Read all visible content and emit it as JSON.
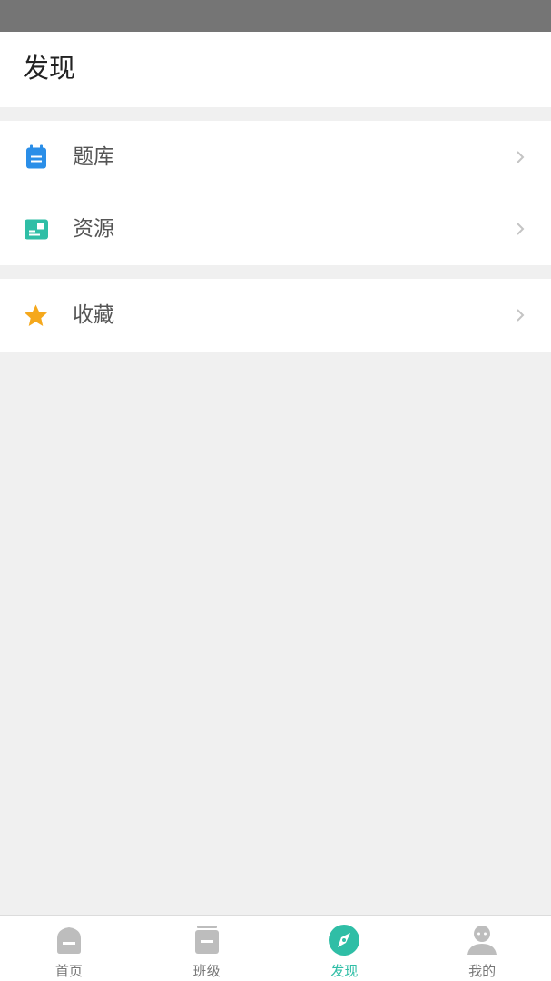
{
  "header": {
    "title": "发现"
  },
  "menu": {
    "groups": [
      {
        "items": [
          {
            "label": "题库",
            "icon": "question-bank-icon",
            "color": "#2a8ee8"
          },
          {
            "label": "资源",
            "icon": "resource-icon",
            "color": "#2fbea6"
          }
        ]
      },
      {
        "items": [
          {
            "label": "收藏",
            "icon": "star-icon",
            "color": "#f5a81c"
          }
        ]
      }
    ]
  },
  "tabbar": {
    "tabs": [
      {
        "label": "首页",
        "icon": "home-icon",
        "active": false
      },
      {
        "label": "班级",
        "icon": "class-icon",
        "active": false
      },
      {
        "label": "发现",
        "icon": "compass-icon",
        "active": true
      },
      {
        "label": "我的",
        "icon": "profile-icon",
        "active": false
      }
    ],
    "active_color": "#2fbea6",
    "inactive_color": "#bdbdbd"
  }
}
